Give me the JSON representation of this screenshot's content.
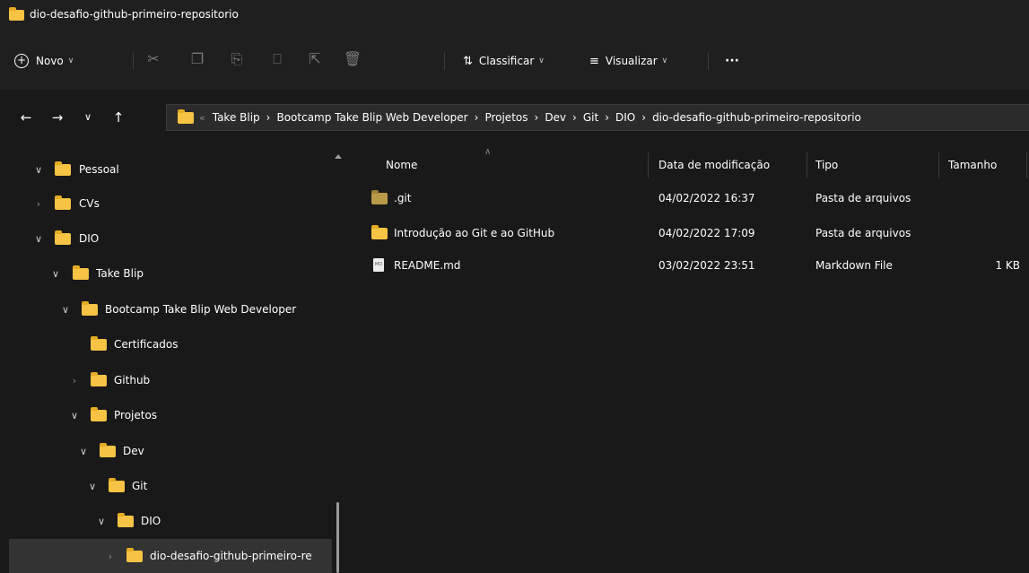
{
  "window": {
    "title": "dio-desafio-github-primeiro-repositorio"
  },
  "toolbar": {
    "new_label": "Novo",
    "sort_label": "Classificar",
    "view_label": "Visualizar",
    "more_label": "···",
    "icons": [
      "plus-circle-icon",
      "cut-icon",
      "copy-icon",
      "paste-icon",
      "rename-icon",
      "share-icon",
      "delete-icon",
      "sort-icon",
      "view-icon"
    ]
  },
  "address": {
    "more_label": "«",
    "crumbs": [
      "Take Blip",
      "Bootcamp Take Blip Web Developer",
      "Projetos",
      "Dev",
      "Git",
      "DIO",
      "dio-desafio-github-primeiro-repositorio"
    ]
  },
  "sidebar": {
    "items": [
      {
        "label": "Pessoal",
        "expanded": true
      },
      {
        "label": "CVs",
        "expanded": false
      },
      {
        "label": "DIO",
        "expanded": true
      },
      {
        "label": "Take Blip",
        "expanded": true
      },
      {
        "label": "Bootcamp Take Blip Web Developer",
        "expanded": true
      },
      {
        "label": "Certificados",
        "expanded": null
      },
      {
        "label": "Github",
        "expanded": false
      },
      {
        "label": "Projetos",
        "expanded": true
      },
      {
        "label": "Dev",
        "expanded": true
      },
      {
        "label": "Git",
        "expanded": true
      },
      {
        "label": "DIO",
        "expanded": true
      },
      {
        "label": "dio-desafio-github-primeiro-re",
        "expanded": false,
        "selected": true
      }
    ]
  },
  "filelist": {
    "columns": {
      "name": "Nome",
      "modified": "Data de modificação",
      "type": "Tipo",
      "size": "Tamanho"
    },
    "rows": [
      {
        "name": ".git",
        "modified": "04/02/2022 16:37",
        "type": "Pasta de arquivos",
        "size": "",
        "icon": "folder-icon"
      },
      {
        "name": "Introdução ao Git e ao GitHub",
        "modified": "04/02/2022 17:09",
        "type": "Pasta de arquivos",
        "size": "",
        "icon": "folder-icon"
      },
      {
        "name": "README.md",
        "modified": "03/02/2022 23:51",
        "type": "Markdown File",
        "size": "1 KB",
        "icon": "markdown-file-icon"
      }
    ]
  },
  "colors": {
    "folder": "#f6c344",
    "background": "#191919",
    "selected": "#333333"
  }
}
